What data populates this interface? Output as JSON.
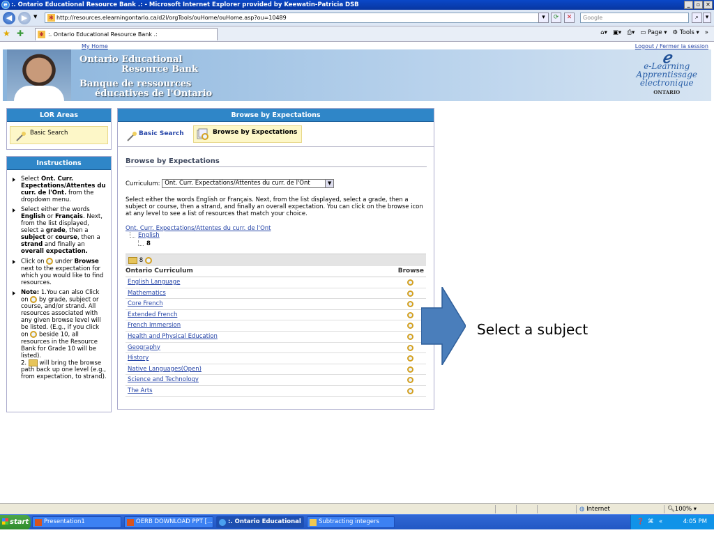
{
  "window": {
    "title": ":. Ontario Educational Resource Bank .: - Microsoft Internet Explorer provided by Keewatin-Patricia DSB"
  },
  "browser": {
    "url": "http://resources.elearningontario.ca/d2l/orgTools/ouHome/ouHome.asp?ou=10489",
    "search_placeholder": "Google",
    "tab_title": ":. Ontario Educational Resource Bank .:",
    "tools": {
      "page": "Page",
      "tools": "Tools"
    }
  },
  "header": {
    "my_home": "My Home",
    "logout": "Logout / Fermer la session",
    "banner": {
      "line1": "Ontario Educational",
      "line2": "Resource Bank",
      "line3": "Banque de ressources",
      "line4": "éducatives de l'Ontario"
    },
    "logo": {
      "line1": "e-Learning",
      "line2": "Apprentissage",
      "line3": "électronique",
      "line4": "ONTARIO"
    }
  },
  "lor": {
    "title": "LOR Areas",
    "basic_search": "Basic Search"
  },
  "instructions": {
    "title": "Instructions",
    "i1a": "Select ",
    "i1b": "Ont. Curr. Expectations/Attentes du curr. de l'Ont.",
    "i1c": " from the dropdown menu.",
    "i2a": "Select either the words ",
    "i2b": "English",
    "i2c": " or ",
    "i2d": "Français",
    "i2e": ". Next, from the list displayed, select a ",
    "i2f": "grade",
    "i2g": ", then a ",
    "i2h": "subject",
    "i2i": " or ",
    "i2j": "course",
    "i2k": ", then a ",
    "i2l": "strand",
    "i2m": " and finally an ",
    "i2n": "overall expectation.",
    "i3a": "Click on ",
    "i3b": " under ",
    "i3c": "Browse",
    "i3d": " next to the expectation for which you would like to find resources.",
    "i4a": "Note:",
    "i4b": " 1.You can also Click on ",
    "i4c": " by grade, subject or course, and/or strand. All resources associated with any given browse level will be listed. (E.g., if you click on ",
    "i4d": " beside 10, all resources in the Resource Bank for Grade 10 will be listed).",
    "i4e": "2. ",
    "i4f": " will bring the browse path back up one level (e.g., from expectation, to strand)."
  },
  "main": {
    "title": "Browse by Expectations",
    "tab_basic": "Basic Search",
    "tab_browse": "Browse by Expectations",
    "section_title": "Browse by Expectations",
    "curriculum_label": "Curriculum:",
    "curriculum_value": "Ont. Curr. Expectations/Attentes du curr. de l'Ont",
    "description": "Select either the words English or Français. Next, from the list displayed, select a grade, then a subject or course, then a strand, and finally an overall expectation. You can click on the browse icon at any level to see a list of resources that match your choice.",
    "breadcrumb": {
      "root": "Ont. Curr. Expectations/Attentes du curr. de l'Ont",
      "lang": "English",
      "grade": "8"
    },
    "toolbar_grade": "8",
    "col_curriculum": "Ontario Curriculum",
    "col_browse": "Browse",
    "subjects": [
      "English Language",
      "Mathematics",
      "Core French",
      "Extended French",
      "French Immersion",
      "Health and Physical Education",
      "Geography",
      "History",
      "Native Languages(Open)",
      "Science and Technology",
      "The Arts"
    ]
  },
  "callout": {
    "text": "Select a subject",
    "arrow_color": "#4a7ebb"
  },
  "status": {
    "zone": "Internet",
    "zoom": "100%"
  },
  "taskbar": {
    "start": "start",
    "tasks": [
      "Presentation1",
      "OERB DOWNLOAD PPT [...",
      ":. Ontario Educational ...",
      "Subtracting integers"
    ],
    "clock": "4:05 PM"
  }
}
